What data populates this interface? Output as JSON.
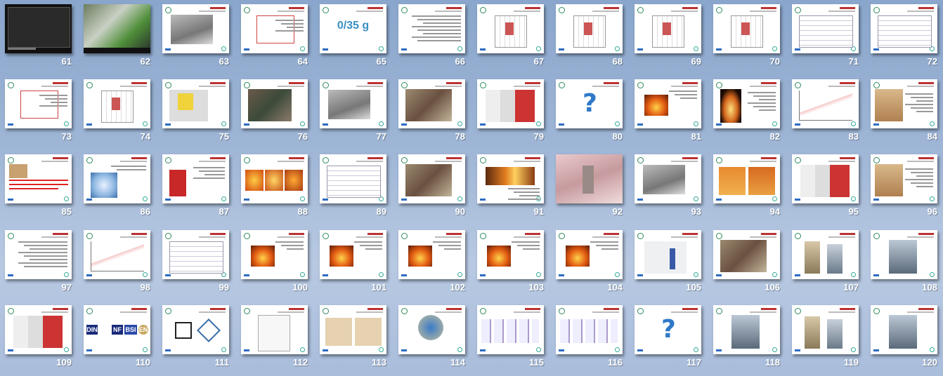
{
  "slides": [
    {
      "n": "61",
      "kind": "dark"
    },
    {
      "n": "62",
      "kind": "photo-green"
    },
    {
      "n": "63",
      "kind": "photo-gray"
    },
    {
      "n": "64",
      "kind": "text-box"
    },
    {
      "n": "65",
      "kind": "big-text",
      "text": "0/35 g"
    },
    {
      "n": "66",
      "kind": "text"
    },
    {
      "n": "67",
      "kind": "diagram"
    },
    {
      "n": "68",
      "kind": "diagram"
    },
    {
      "n": "69",
      "kind": "diagram"
    },
    {
      "n": "70",
      "kind": "diagram"
    },
    {
      "n": "71",
      "kind": "table"
    },
    {
      "n": "72",
      "kind": "table"
    },
    {
      "n": "73",
      "kind": "text-box"
    },
    {
      "n": "74",
      "kind": "diagram"
    },
    {
      "n": "75",
      "kind": "photo-yellow"
    },
    {
      "n": "76",
      "kind": "photo-tree"
    },
    {
      "n": "77",
      "kind": "photo-gray"
    },
    {
      "n": "78",
      "kind": "photo-brown"
    },
    {
      "n": "79",
      "kind": "photo-red"
    },
    {
      "n": "80",
      "kind": "question"
    },
    {
      "n": "81",
      "kind": "fire-small"
    },
    {
      "n": "82",
      "kind": "flame"
    },
    {
      "n": "83",
      "kind": "chart"
    },
    {
      "n": "84",
      "kind": "photo-building"
    },
    {
      "n": "85",
      "kind": "photo-text-red"
    },
    {
      "n": "86",
      "kind": "photo-blue"
    },
    {
      "n": "87",
      "kind": "photo-redbox"
    },
    {
      "n": "88",
      "kind": "fire-row"
    },
    {
      "n": "89",
      "kind": "table"
    },
    {
      "n": "90",
      "kind": "photo-brown"
    },
    {
      "n": "91",
      "kind": "fire-wide"
    },
    {
      "n": "92",
      "kind": "photo-pink"
    },
    {
      "n": "93",
      "kind": "photo-gray"
    },
    {
      "n": "94",
      "kind": "fire-orange"
    },
    {
      "n": "95",
      "kind": "photo-red"
    },
    {
      "n": "96",
      "kind": "photo-building"
    },
    {
      "n": "97",
      "kind": "text"
    },
    {
      "n": "98",
      "kind": "chart"
    },
    {
      "n": "99",
      "kind": "table"
    },
    {
      "n": "100",
      "kind": "fire-small"
    },
    {
      "n": "101",
      "kind": "fire-small"
    },
    {
      "n": "102",
      "kind": "fire-small"
    },
    {
      "n": "103",
      "kind": "fire-small"
    },
    {
      "n": "104",
      "kind": "fire-small"
    },
    {
      "n": "105",
      "kind": "photo-worker"
    },
    {
      "n": "106",
      "kind": "photo-brown"
    },
    {
      "n": "107",
      "kind": "photo-towers"
    },
    {
      "n": "108",
      "kind": "photo-tower"
    },
    {
      "n": "109",
      "kind": "photo-red"
    },
    {
      "n": "110",
      "kind": "logos"
    },
    {
      "n": "111",
      "kind": "logos2"
    },
    {
      "n": "112",
      "kind": "certificate"
    },
    {
      "n": "113",
      "kind": "certificate-tan"
    },
    {
      "n": "114",
      "kind": "badge"
    },
    {
      "n": "115",
      "kind": "catalog"
    },
    {
      "n": "116",
      "kind": "catalog"
    },
    {
      "n": "117",
      "kind": "question"
    },
    {
      "n": "118",
      "kind": "photo-tower"
    },
    {
      "n": "119",
      "kind": "photo-towers"
    },
    {
      "n": "120",
      "kind": "photo-tower"
    }
  ],
  "logos": {
    "din": "DIN",
    "nf": "NF",
    "bsi": "BSI",
    "en": "EN"
  }
}
